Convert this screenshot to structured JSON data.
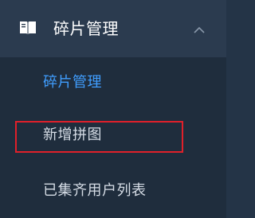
{
  "menu": {
    "title": "碎片管理",
    "icon": "book-icon",
    "expanded": true,
    "items": [
      {
        "label": "碎片管理",
        "active": true
      },
      {
        "label": "新增拼图",
        "active": false,
        "highlighted": true
      },
      {
        "label": "已集齐用户列表",
        "active": false
      }
    ]
  },
  "colors": {
    "background": "#1f2d3d",
    "header_background": "#2b3b4f",
    "active_text": "#409eff",
    "text": "#d6dde6",
    "highlight_border": "#e0202a"
  }
}
